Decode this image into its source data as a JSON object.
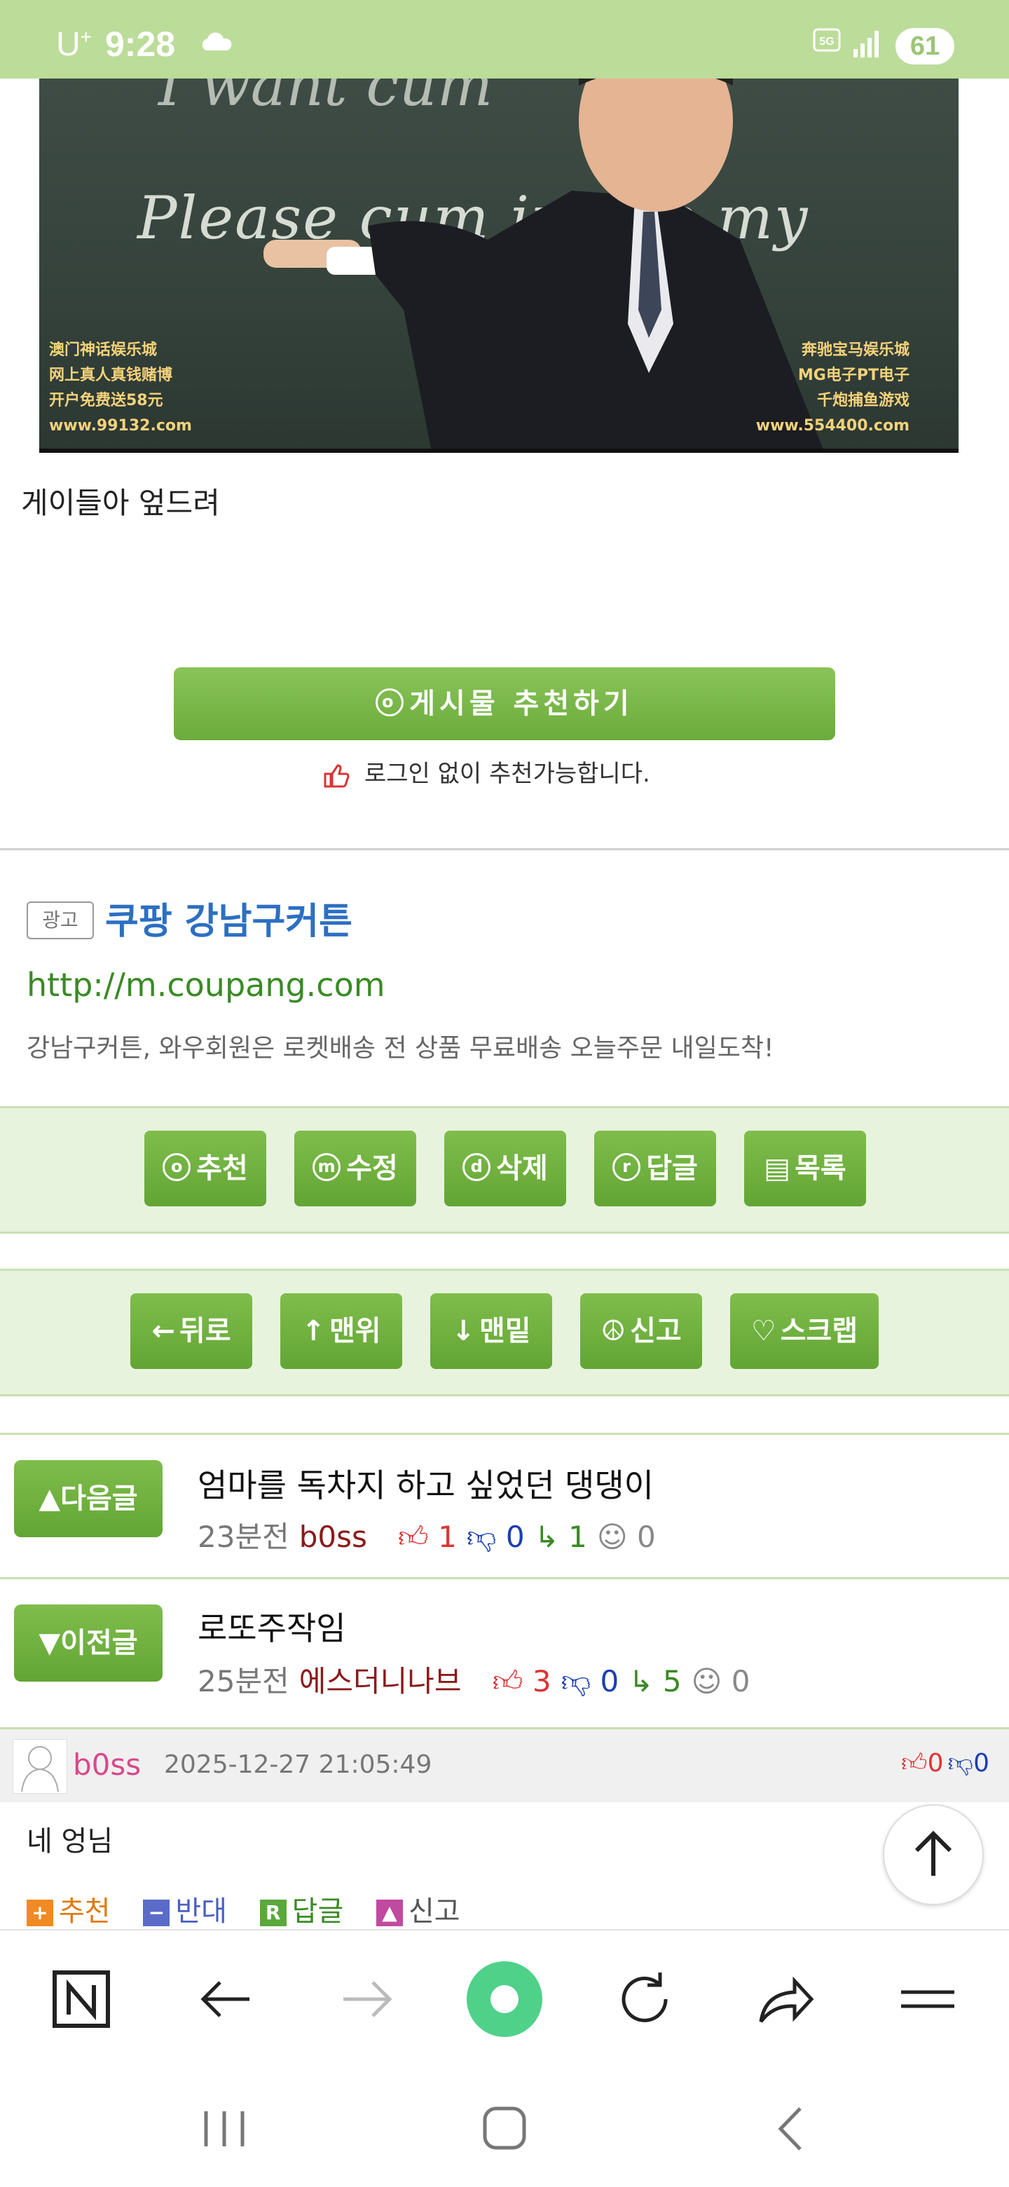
{
  "status_bar": {
    "carrier": "U",
    "carrier_suffix": "+",
    "time": "9:28",
    "network": "5G",
    "battery": "61"
  },
  "post": {
    "image": {
      "board_text_line1": "I want cum",
      "board_text_line2": "Please cum inside my",
      "watermark_left": [
        "澳门神话娱乐城",
        "网上真人真钱赌博",
        "开户免费送58元",
        "www.99132.com"
      ],
      "watermark_right": [
        "奔驰宝马娱乐城",
        "MG电子PT电子",
        "千炮捕鱼游戏",
        "www.554400.com"
      ]
    },
    "body_text": "게이들아  엎드려"
  },
  "recommend": {
    "button_label": "게시물  추천하기",
    "note": "로그인 없이 추천가능합니다."
  },
  "ad": {
    "badge": "광고",
    "title": "쿠팡 강남구커튼",
    "url": "http://m.coupang.com",
    "description": "강남구커튼, 와우회원은 로켓배송 전 상품 무료배송 오늘주문 내일도착!"
  },
  "toolbar1": [
    {
      "glyph": "o",
      "label": "추천"
    },
    {
      "glyph": "m",
      "label": "수정"
    },
    {
      "glyph": "d",
      "label": "삭제"
    },
    {
      "glyph": "r",
      "label": "답글"
    },
    {
      "glyph": "▤",
      "label": "목록"
    }
  ],
  "toolbar2": [
    {
      "glyph": "←",
      "label": "뒤로"
    },
    {
      "glyph": "↑",
      "label": "맨위"
    },
    {
      "glyph": "↓",
      "label": "맨밑"
    },
    {
      "glyph": "☮",
      "label": "신고"
    },
    {
      "glyph": "♡",
      "label": "스크랩"
    }
  ],
  "next_post": {
    "button": "▲다음글",
    "title": "엄마를 독차지 하고 싶었던 댕댕이",
    "time": "23분전",
    "author": "b0ss",
    "up": "1",
    "down": "0",
    "replies": "1",
    "comments": "0"
  },
  "prev_post": {
    "button": "▼이전글",
    "title": "로또주작임",
    "time": "25분전",
    "author": "에스더니나브",
    "up": "3",
    "down": "0",
    "replies": "5",
    "comments": "0"
  },
  "comment": {
    "author": "b0ss",
    "date": "2025-12-27 21:05:49",
    "up": "0",
    "down": "0",
    "text": "네 엉님",
    "actions": {
      "recommend": "추천",
      "oppose": "반대",
      "reply": "답글",
      "report": "신고"
    }
  },
  "colors": {
    "status_bar": "#bcdc9a",
    "button_green": "#6aab3a",
    "toolbar_bg": "#e8f3dd",
    "ad_title": "#2c6fc2",
    "ad_url": "#3a8a25"
  },
  "icons": [
    "cloud-icon",
    "signal-icon",
    "thumb-up-icon",
    "arrow-up-icon",
    "n-logo-icon",
    "back-icon",
    "forward-icon",
    "home-dot-icon",
    "refresh-icon",
    "share-icon",
    "menu-icon"
  ]
}
